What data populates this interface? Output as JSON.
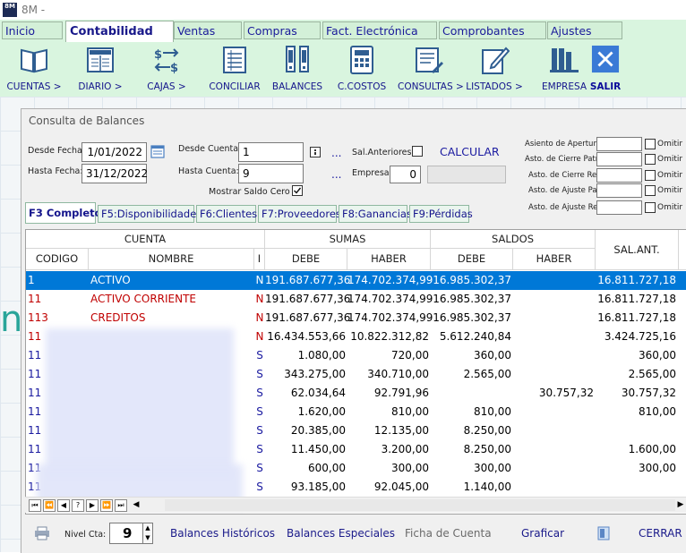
{
  "window": {
    "title": "8M -",
    "icon_text": "8M"
  },
  "menu_tabs": [
    {
      "label": "Inicio"
    },
    {
      "label": "Contabilidad"
    },
    {
      "label": "Ventas"
    },
    {
      "label": "Compras"
    },
    {
      "label": "Fact. Electrónica"
    },
    {
      "label": "Comprobantes"
    },
    {
      "label": "Ajustes"
    }
  ],
  "toolbar": [
    {
      "label": "CUENTAS >",
      "icon": "book-icon"
    },
    {
      "label": "DIARIO >",
      "icon": "journal-icon"
    },
    {
      "label": "CAJAS >",
      "icon": "currency-exchange-icon"
    },
    {
      "label": "CONCILIAR",
      "icon": "list-icon"
    },
    {
      "label": "BALANCES",
      "icon": "balance-icon"
    },
    {
      "label": "C.COSTOS",
      "icon": "calculator-icon"
    },
    {
      "label": "CONSULTAS >",
      "icon": "report-icon"
    },
    {
      "label": "LISTADOS >",
      "icon": "edit-document-icon"
    },
    {
      "label": "EMPRESA",
      "icon": "building-icon"
    },
    {
      "label": "SALIR",
      "icon": "close-icon"
    }
  ],
  "dialog": {
    "title": "Consulta de Balances",
    "desde_fecha": {
      "label": "Desde Fecha:",
      "value": "1/01/2022"
    },
    "hasta_fecha": {
      "label": "Hasta Fecha:",
      "value": "31/12/2022"
    },
    "desde_cuenta": {
      "label": "Desde Cuenta:",
      "value": "1"
    },
    "hasta_cuenta": {
      "label": "Hasta Cuenta:",
      "value": "9"
    },
    "mostrar_saldo_cero": {
      "label": "Mostrar Saldo Cero",
      "checked": true
    },
    "sal_anteriores": {
      "label": "Sal.Anteriores:",
      "checked": false
    },
    "empresa": {
      "label": "Empresa:",
      "value": "0"
    },
    "calcular_label": "CALCULAR",
    "ellipsis": "...",
    "asientos": [
      {
        "label": "Asiento de Apertura",
        "omit": "Omitir"
      },
      {
        "label": "Asto. de Cierre Patr.",
        "omit": "Omitir"
      },
      {
        "label": "Asto. de Cierre Res",
        "omit": "Omitir"
      },
      {
        "label": "Asto. de Ajuste Pat",
        "omit": "Omitir"
      },
      {
        "label": "Asto. de Ajuste Res",
        "omit": "Omitir"
      }
    ],
    "sub_tabs": [
      {
        "label": "F3 Completo"
      },
      {
        "label": "F5:Disponibilidades"
      },
      {
        "label": "F6:Clientes"
      },
      {
        "label": "F7:Proveedores"
      },
      {
        "label": "F8:Ganancias"
      },
      {
        "label": "F9:Pérdidas"
      }
    ]
  },
  "grid": {
    "group_headers": {
      "cuenta": "CUENTA",
      "sumas": "SUMAS",
      "saldos": "SALDOS",
      "sal_ant": "SAL.ANT."
    },
    "columns": {
      "codigo": "CODIGO",
      "nombre": "NOMBRE",
      "i": "I",
      "debe": "DEBE",
      "haber": "HABER",
      "saldo_debe": "DEBE",
      "saldo_haber": "HABER"
    },
    "rows": [
      {
        "codigo": "1",
        "nombre": "ACTIVO",
        "i": "N",
        "debe": "191.687.677,36",
        "haber": "174.702.374,99",
        "s_debe": "16.985.302,37",
        "s_haber": "",
        "sal_ant": "16.811.727,18",
        "selected": true,
        "color": "#c00000"
      },
      {
        "codigo": "11",
        "nombre": "ACTIVO CORRIENTE",
        "i": "N",
        "debe": "191.687.677,36",
        "haber": "174.702.374,99",
        "s_debe": "16.985.302,37",
        "s_haber": "",
        "sal_ant": "16.811.727,18",
        "selected": false,
        "color": "#c00000"
      },
      {
        "codigo": "113",
        "nombre": "CREDITOS",
        "i": "N",
        "debe": "191.687.677,36",
        "haber": "174.702.374,99",
        "s_debe": "16.985.302,37",
        "s_haber": "",
        "sal_ant": "16.811.727,18",
        "selected": false,
        "color": "#c00000"
      },
      {
        "codigo": "11",
        "nombre": "",
        "i": "N",
        "debe": "16.434.553,66",
        "haber": "10.822.312,82",
        "s_debe": "5.612.240,84",
        "s_haber": "",
        "sal_ant": "3.424.725,16",
        "selected": false,
        "color": "#c00000"
      },
      {
        "codigo": "11",
        "nombre": "",
        "i": "S",
        "debe": "1.080,00",
        "haber": "720,00",
        "s_debe": "360,00",
        "s_haber": "",
        "sal_ant": "360,00",
        "selected": false,
        "color": "#1a1aa0"
      },
      {
        "codigo": "11",
        "nombre": "",
        "i": "S",
        "debe": "343.275,00",
        "haber": "340.710,00",
        "s_debe": "2.565,00",
        "s_haber": "",
        "sal_ant": "2.565,00",
        "selected": false,
        "color": "#1a1aa0"
      },
      {
        "codigo": "11",
        "nombre": "",
        "i": "S",
        "debe": "62.034,64",
        "haber": "92.791,96",
        "s_debe": "",
        "s_haber": "30.757,32",
        "sal_ant": "30.757,32",
        "selected": false,
        "color": "#1a1aa0"
      },
      {
        "codigo": "11",
        "nombre": "",
        "i": "S",
        "debe": "1.620,00",
        "haber": "810,00",
        "s_debe": "810,00",
        "s_haber": "",
        "sal_ant": "810,00",
        "selected": false,
        "color": "#1a1aa0"
      },
      {
        "codigo": "11",
        "nombre": "",
        "i": "S",
        "debe": "20.385,00",
        "haber": "12.135,00",
        "s_debe": "8.250,00",
        "s_haber": "",
        "sal_ant": "",
        "selected": false,
        "color": "#1a1aa0"
      },
      {
        "codigo": "11",
        "nombre": "",
        "i": "S",
        "debe": "11.450,00",
        "haber": "3.200,00",
        "s_debe": "8.250,00",
        "s_haber": "",
        "sal_ant": "1.600,00",
        "selected": false,
        "color": "#1a1aa0"
      },
      {
        "codigo": "11",
        "nombre": "",
        "i": "S",
        "debe": "600,00",
        "haber": "300,00",
        "s_debe": "300,00",
        "s_haber": "",
        "sal_ant": "300,00",
        "selected": false,
        "color": "#1a1aa0"
      },
      {
        "codigo": "11",
        "nombre": "",
        "i": "S",
        "debe": "93.185,00",
        "haber": "92.045,00",
        "s_debe": "1.140,00",
        "s_haber": "",
        "sal_ant": "",
        "selected": false,
        "color": "#1a1aa0"
      }
    ]
  },
  "bottom": {
    "nivel_label": "Nivel Cta:",
    "nivel_value": "9",
    "links": [
      {
        "label": "Balances Históricos",
        "enabled": true
      },
      {
        "label": "Balances Especiales",
        "enabled": true
      },
      {
        "label": "Ficha de Cuenta",
        "enabled": false
      },
      {
        "label": "Graficar",
        "enabled": true
      },
      {
        "label": "CERRAR",
        "enabled": true
      }
    ]
  },
  "background_letter": "n"
}
